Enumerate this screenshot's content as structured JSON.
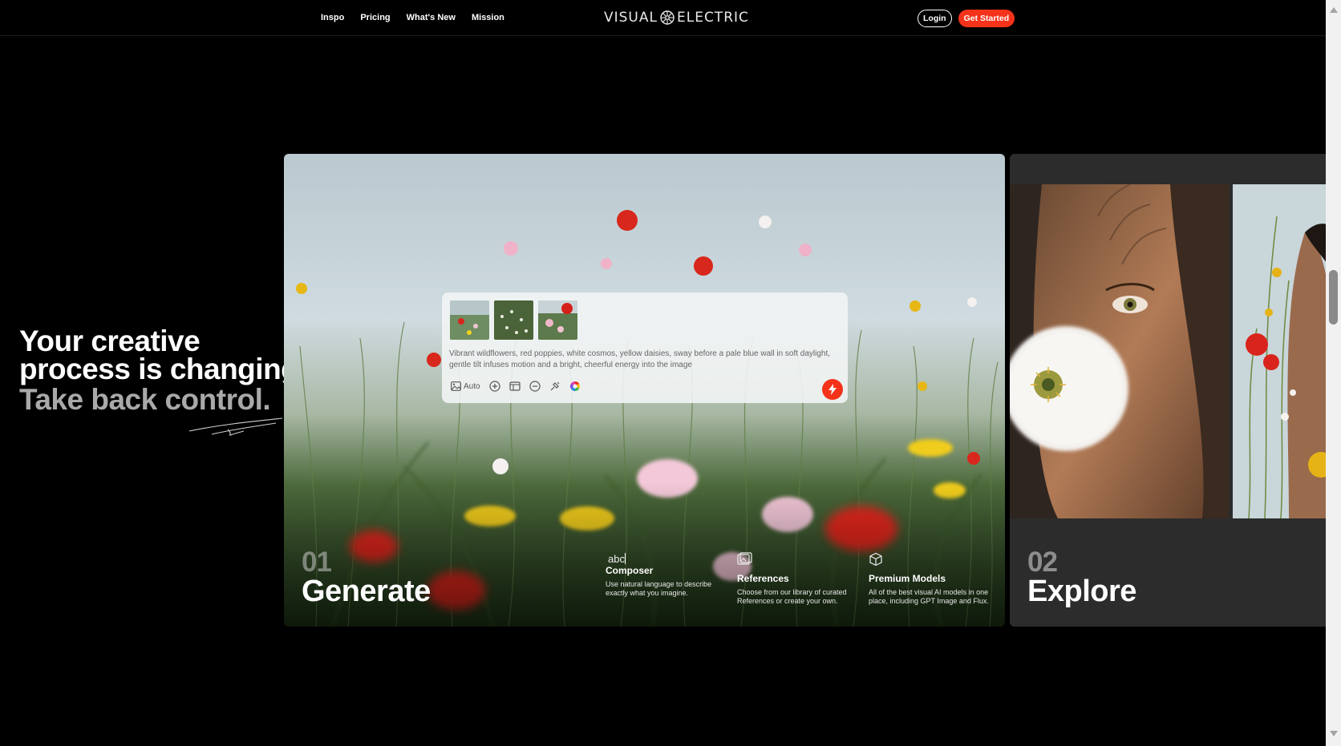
{
  "nav": {
    "links": [
      "Inspo",
      "Pricing",
      "What's New",
      "Mission"
    ],
    "logo_left": "VISUAL",
    "logo_right": "ELECTRIC",
    "login": "Login",
    "get_started": "Get Started"
  },
  "hero": {
    "line1": "Your creative",
    "line2": "process is changing.",
    "line3": "Take back control."
  },
  "generate_card": {
    "number": "01",
    "title": "Generate",
    "typed_text": "abc",
    "composer": {
      "prompt": "Vibrant wildflowers, red poppies, white cosmos, yellow daisies, sway before a pale blue wall in soft daylight, gentle tilt infuses motion and a bright, cheerful energy into the image",
      "auto_label": "Auto"
    },
    "features": [
      {
        "icon": "composer-icon",
        "title": "Composer",
        "desc": "Use natural language to describe exactly what you imagine."
      },
      {
        "icon": "references-icon",
        "title": "References",
        "desc": "Choose from our library of curated References or create your own."
      },
      {
        "icon": "cube-icon",
        "title": "Premium Models",
        "desc": "All of the best visual AI models in one place, including GPT Image and Flux."
      }
    ]
  },
  "explore_card": {
    "number": "02",
    "title": "Explore"
  },
  "colors": {
    "accent": "#f5321a",
    "background": "#000000",
    "card_dark": "#2c2c2c",
    "sky": "#c9d7dd"
  }
}
